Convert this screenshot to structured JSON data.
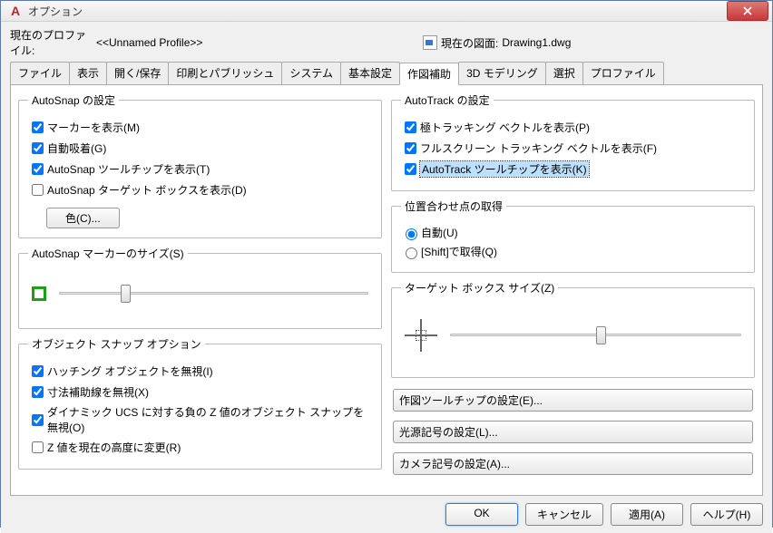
{
  "titlebar": {
    "title": "オプション"
  },
  "profile": {
    "label": "現在のプロファイル:",
    "value": "<<Unnamed Profile>>",
    "drawing_label": "現在の図面:",
    "drawing_value": "Drawing1.dwg"
  },
  "tabs": [
    "ファイル",
    "表示",
    "開く/保存",
    "印刷とパブリッシュ",
    "システム",
    "基本設定",
    "作図補助",
    "3D モデリング",
    "選択",
    "プロファイル"
  ],
  "active_tab": "作図補助",
  "groups": {
    "autosnap": {
      "legend": "AutoSnap の設定",
      "marker": {
        "label": "マーカーを表示(M)",
        "checked": true
      },
      "magnet": {
        "label": "自動吸着(G)",
        "checked": true
      },
      "tooltip": {
        "label": "AutoSnap ツールチップを表示(T)",
        "checked": true
      },
      "aperture_box": {
        "label": "AutoSnap ターゲット ボックスを表示(D)",
        "checked": false
      },
      "color_btn": "色(C)..."
    },
    "marker_size": {
      "legend": "AutoSnap マーカーのサイズ(S)",
      "value": 20
    },
    "osnap_options": {
      "legend": "オブジェクト スナップ オプション",
      "hatch": {
        "label": "ハッチング オブジェクトを無視(I)",
        "checked": true
      },
      "ext": {
        "label": "寸法補助線を無視(X)",
        "checked": true
      },
      "neg_z": {
        "label": "ダイナミック UCS に対する負の Z 値のオブジェクト スナップを無視(O)",
        "checked": true
      },
      "replace_z": {
        "label": "Z 値を現在の高度に変更(R)",
        "checked": false
      }
    },
    "autotrack": {
      "legend": "AutoTrack の設定",
      "polar": {
        "label": "極トラッキング ベクトルを表示(P)",
        "checked": true
      },
      "full": {
        "label": "フルスクリーン トラッキング ベクトルを表示(F)",
        "checked": true
      },
      "tooltip": {
        "label": "AutoTrack ツールチップを表示(K)",
        "checked": true
      }
    },
    "alignment": {
      "legend": "位置合わせ点の取得",
      "auto": {
        "label": "自動(U)",
        "selected": true
      },
      "shift": {
        "label": "[Shift]で取得(Q)",
        "selected": false
      }
    },
    "target_size": {
      "legend": "ターゲット ボックス サイズ(Z)",
      "value": 50
    },
    "right_buttons": {
      "drafting": "作図ツールチップの設定(E)...",
      "light": "光源記号の設定(L)...",
      "camera": "カメラ記号の設定(A)..."
    }
  },
  "buttons": {
    "ok": "OK",
    "cancel": "キャンセル",
    "apply": "適用(A)",
    "help": "ヘルプ(H)"
  }
}
